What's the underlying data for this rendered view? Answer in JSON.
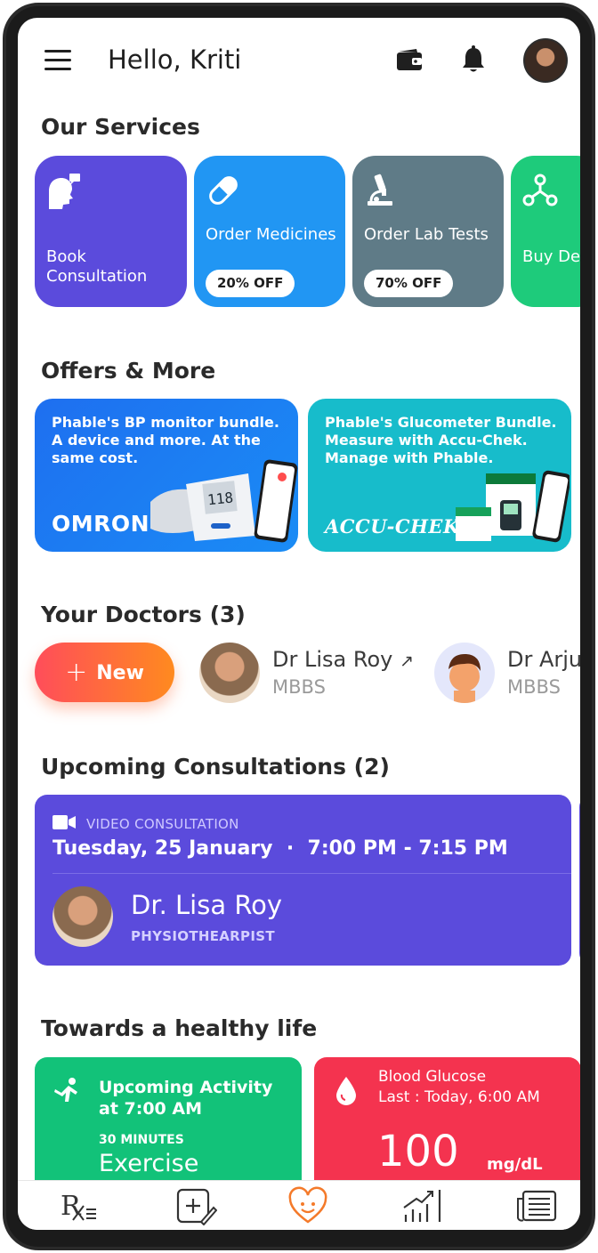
{
  "header": {
    "greeting": "Hello, Kriti"
  },
  "services": {
    "title": "Our Services",
    "items": [
      {
        "label": "Book Consultation",
        "badge": "",
        "color": "#5b4bdc",
        "icon": "doctor-chat-icon"
      },
      {
        "label": "Order Medicines",
        "badge": "20% OFF",
        "color": "#2196f3",
        "icon": "pill-icon"
      },
      {
        "label": "Order Lab Tests",
        "badge": "70% OFF",
        "color": "#5f7b87",
        "icon": "microscope-icon"
      },
      {
        "label": "Buy Devices",
        "badge": "",
        "color": "#1ecb7b",
        "icon": "device-nodes-icon"
      }
    ]
  },
  "offers": {
    "title": "Offers & More",
    "items": [
      {
        "text": "Phable's BP monitor bundle. A device and more. At the same cost.",
        "brand": "OMRON",
        "color": "#1d7cf2",
        "device_reading": "118"
      },
      {
        "text": "Phable's Glucometer Bundle. Measure with Accu-Chek. Manage with Phable.",
        "brand": "ACCU-CHEK",
        "color": "#17bccb"
      }
    ]
  },
  "doctors": {
    "title": "Your Doctors (3)",
    "new_label": "New",
    "items": [
      {
        "name": "Dr Lisa Roy",
        "degree": "MBBS"
      },
      {
        "name": "Dr Arjun",
        "degree": "MBBS"
      }
    ]
  },
  "consultations": {
    "title": "Upcoming Consultations (2)",
    "type": "VIDEO CONSULTATION",
    "date": "Tuesday, 25 January",
    "separator": "·",
    "time": "7:00 PM - 7:15 PM",
    "doctor": "Dr. Lisa Roy",
    "role": "PHYSIOTHEARPIST"
  },
  "health": {
    "title": "Towards a healthy life",
    "activity": {
      "heading": "Upcoming Activity at 7:00 AM",
      "duration": "30 MINUTES",
      "name": "Exercise",
      "color": "#12c279"
    },
    "glucose": {
      "heading": "Blood Glucose",
      "last": "Last : Today, 6:00 AM",
      "value": "100",
      "unit": "mg/dL",
      "color": "#f4334f"
    }
  },
  "bottom_nav": [
    {
      "icon": "prescription-icon"
    },
    {
      "icon": "add-record-icon"
    },
    {
      "icon": "heart-smile-icon",
      "active": true,
      "accent": "#f47a2a"
    },
    {
      "icon": "analytics-icon"
    },
    {
      "icon": "news-icon"
    }
  ]
}
